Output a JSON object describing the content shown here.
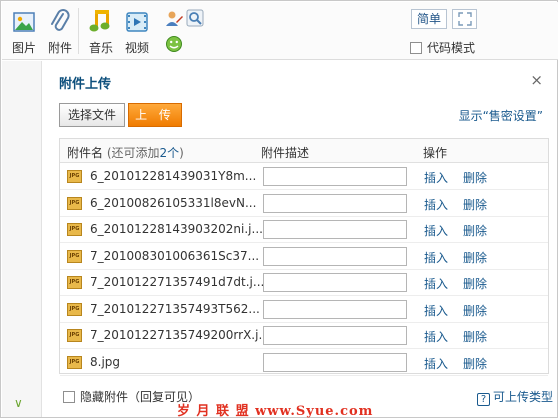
{
  "toolbar": {
    "tools": [
      {
        "label": "图片",
        "icon": "image-icon"
      },
      {
        "label": "附件",
        "icon": "paperclip-icon"
      },
      {
        "label": "音乐",
        "icon": "music-note-icon"
      },
      {
        "label": "视频",
        "icon": "film-icon"
      }
    ],
    "small_icons": [
      "user-edit-icon",
      "magnifier-icon",
      "emoticon-icon"
    ],
    "simple_label": "简单",
    "expand_icon": "expand-icon",
    "code_mode_label": "代码模式",
    "code_mode_checked": false
  },
  "dialog": {
    "title": "附件上传",
    "close": "×",
    "choose_file": "选择文件",
    "upload": "上 传",
    "advanced_link": "显示“售密设置”",
    "table": {
      "col_name": "附件名",
      "col_name_hint_prefix": "(还可添加",
      "col_name_hint_count": "2个",
      "col_name_hint_suffix": ")",
      "col_desc": "附件描述",
      "col_action": "操作",
      "icon_text": "JPG",
      "rows": [
        {
          "name": "6_201012281439031Y8m...",
          "insert": "插入",
          "delete": "删除"
        },
        {
          "name": "6_20100826105331l8evN...",
          "insert": "插入",
          "delete": "删除"
        },
        {
          "name": "6_20101228143903202ni.j...",
          "insert": "插入",
          "delete": "删除"
        },
        {
          "name": "7_201008301006361Sc37...",
          "insert": "插入",
          "delete": "删除"
        },
        {
          "name": "7_201012271357491d7dt.j...",
          "insert": "插入",
          "delete": "删除"
        },
        {
          "name": "7_201012271357493T562...",
          "insert": "插入",
          "delete": "删除"
        },
        {
          "name": "7_20101227135749200rrX.j...",
          "insert": "插入",
          "delete": "删除"
        },
        {
          "name": "8.jpg",
          "insert": "插入",
          "delete": "删除"
        }
      ]
    },
    "hide_attachment_label": "隐藏附件（回复可见）",
    "help_icon": "?",
    "help_link": "可上传类型"
  },
  "watermark": "岁 月 联 盟   www.Syue.com",
  "colors": {
    "accent": "#1a5a8e",
    "upload_button": "#f07c00",
    "title": "#0d4f7c",
    "watermark": "#e13020"
  }
}
